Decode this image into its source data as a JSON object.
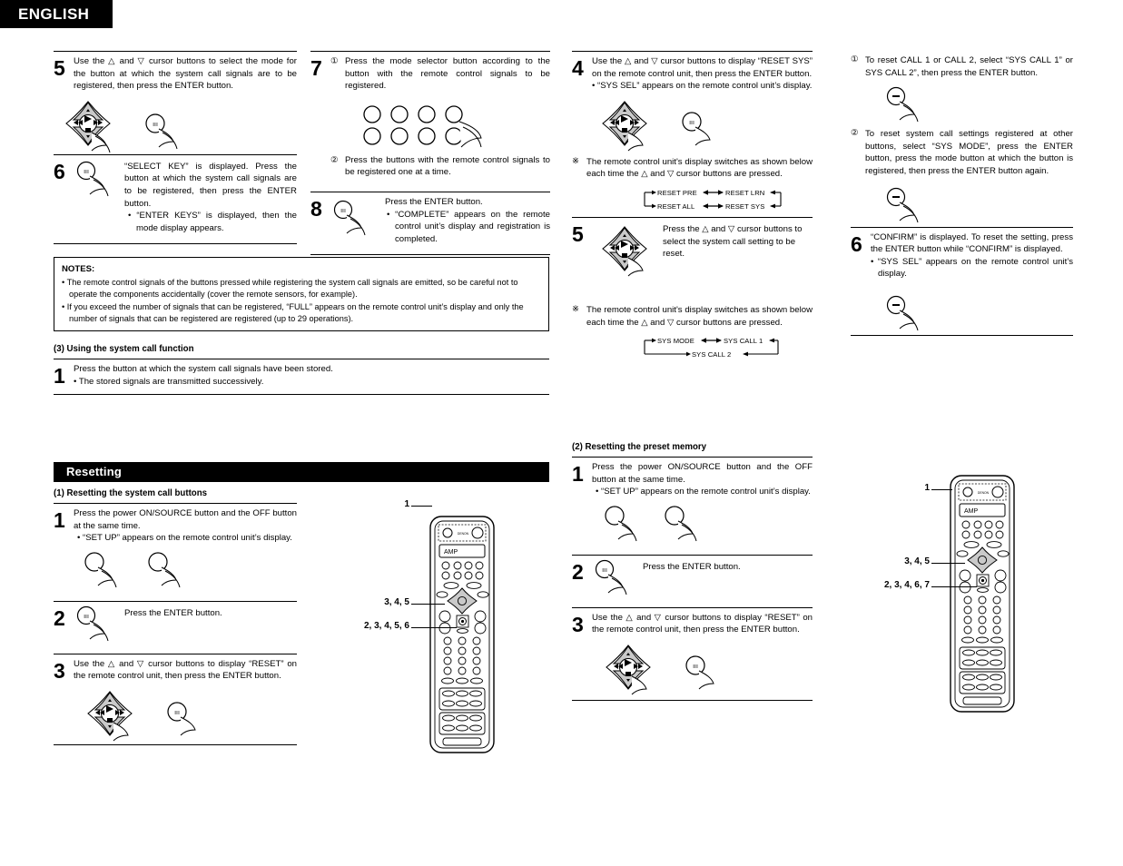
{
  "header": {
    "language": "ENGLISH"
  },
  "col1": {
    "step5": {
      "num": "5",
      "text": "Use the △ and ▽ cursor buttons to select the mode for the button at which the system call signals are to be registered, then press the ENTER button."
    },
    "step6": {
      "num": "6",
      "text": "“SELECT KEY” is displayed. Press the button at which the system call signals are to be registered, then press the ENTER button.",
      "bullet": "• “ENTER KEYS” is displayed, then the mode display appears."
    },
    "notes": {
      "title": "NOTES:",
      "items": [
        "• The remote control signals of the buttons pressed while registering the system call signals are emitted, so be careful not to operate the components accidentally (cover the remote sensors, for example).",
        "• If you exceed the number of signals that can be registered, “FULL” appears on the remote control unit’s display and only the number of signals that can be registered are registered (up to 29 operations)."
      ]
    },
    "section3": {
      "title": "(3)  Using the system call function"
    },
    "step1": {
      "num": "1",
      "text": "Press the button at which the system call signals have been stored.",
      "bullet": "• The stored signals are transmitted successively."
    },
    "resetting_bar": "Resetting",
    "section1": {
      "title": "(1)  Resetting the system call buttons"
    },
    "r_step1": {
      "num": "1",
      "text": "Press the power ON/SOURCE button and the OFF button at the same time.",
      "bullet": "• “SET UP” appears on the remote control unit’s display."
    },
    "r_step2": {
      "num": "2",
      "text": "Press the ENTER button."
    },
    "r_step3": {
      "num": "3",
      "text": "Use the △ and ▽ cursor buttons to display “RESET” on the remote control unit, then press the ENTER button."
    }
  },
  "col2": {
    "step7": {
      "num": "7",
      "sub1_mark": "①",
      "sub1_text": "Press the mode selector button according to the button with the remote control signals to be registered.",
      "sub2_mark": "②",
      "sub2_text": "Press the buttons with the remote control signals to be registered one at a time."
    },
    "step8": {
      "num": "8",
      "text": "Press the ENTER button.",
      "bullet": "• “COMPLETE” appears on the remote control unit’s display and registration is completed."
    },
    "remote": {
      "brand": "DENON",
      "display": "AMP",
      "callout_top": "1",
      "callout_mid": "3, 4, 5",
      "callout_low": "2, 3, 4, 5, 6"
    }
  },
  "col3": {
    "step4": {
      "num": "4",
      "text": "Use the △ and ▽ cursor buttons to display “RESET SYS” on the remote control unit, then press the ENTER button.",
      "bullet": "• “SYS SEL” appears on the remote control unit’s display.",
      "note_mark": "※",
      "note_text": "The remote control unit's display switches as shown below each time the △ and ▽ cursor buttons are pressed.",
      "flow": {
        "a": "RESET PRE",
        "b": "RESET LRN",
        "c": "RESET ALL",
        "d": "RESET SYS"
      }
    },
    "step5": {
      "num": "5",
      "text": "Press the △ and ▽ cursor buttons to select the system call setting to be reset.",
      "note_mark": "※",
      "note_text": "The remote control unit's display switches as shown below each time the △ and ▽ cursor buttons are pressed.",
      "flow": {
        "a": "SYS MODE",
        "b": "SYS CALL 1",
        "c": "SYS CALL 2"
      }
    },
    "section2": {
      "title": "(2)  Resetting the preset memory"
    },
    "p_step1": {
      "num": "1",
      "text": "Press the power ON/SOURCE button and the OFF button at the same time.",
      "bullet": "• “SET UP” appears on the remote control unit’s display."
    },
    "p_step2": {
      "num": "2",
      "text": "Press the ENTER button."
    },
    "p_step3": {
      "num": "3",
      "text": "Use the △ and ▽ cursor buttons to display “RESET” on the remote control unit, then press the ENTER button."
    }
  },
  "col4": {
    "sub1": {
      "mark": "①",
      "text": "To reset CALL 1 or CALL 2, select “SYS CALL 1” or SYS CALL 2”, then press the ENTER button."
    },
    "sub2": {
      "mark": "②",
      "text": "To reset system call settings registered at other buttons, select “SYS MODE”, press the ENTER button, press the mode button at which the button is registered, then press the ENTER button again."
    },
    "step6": {
      "num": "6",
      "text": "“CONFIRM” is displayed.  To reset the setting, press the ENTER button while “CONFIRM” is displayed.",
      "bullet": "• “SYS SEL” appears on the remote control unit’s display."
    },
    "remote": {
      "brand": "DENON",
      "display": "AMP",
      "callout_top": "1",
      "callout_mid": "3, 4, 5",
      "callout_low": "2, 3, 4, 6, 7"
    }
  }
}
